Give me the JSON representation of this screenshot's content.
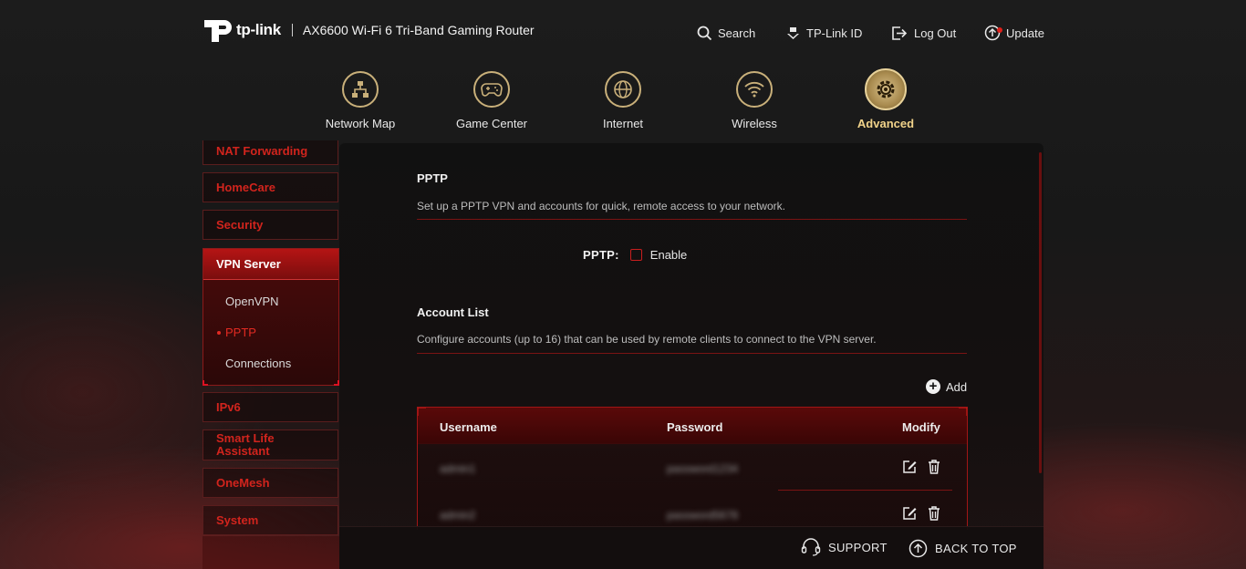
{
  "header": {
    "brand": "tp-link",
    "model": "AX6600 Wi-Fi 6 Tri-Band Gaming Router",
    "links": {
      "search": "Search",
      "tplink_id": "TP-Link ID",
      "logout": "Log Out",
      "update": "Update"
    }
  },
  "main_nav": {
    "network_map": "Network Map",
    "game_center": "Game Center",
    "internet": "Internet",
    "wireless": "Wireless",
    "advanced": "Advanced"
  },
  "sidebar": {
    "nat_forwarding": "NAT Forwarding",
    "homecare": "HomeCare",
    "security": "Security",
    "vpn_server": "VPN Server",
    "openvpn": "OpenVPN",
    "pptp": "PPTP",
    "connections": "Connections",
    "ipv6": "IPv6",
    "smart_life_line1": "Smart Life",
    "smart_life_line2": "Assistant",
    "onemesh": "OneMesh",
    "system": "System"
  },
  "pptp_section": {
    "title": "PPTP",
    "description": "Set up a PPTP VPN and accounts for quick, remote access to your network.",
    "field_label": "PPTP:",
    "enable_label": "Enable",
    "enabled": false
  },
  "account_section": {
    "title": "Account List",
    "description": "Configure accounts (up to 16) that can be used by remote clients to connect to the VPN server.",
    "add_label": "Add",
    "columns": {
      "username": "Username",
      "password": "Password",
      "modify": "Modify"
    },
    "rows": [
      {
        "username": "admin1",
        "password": "password1234"
      },
      {
        "username": "admin2",
        "password": "password5678"
      }
    ]
  },
  "footer": {
    "support": "SUPPORT",
    "back_to_top": "BACK TO TOP"
  },
  "colors": {
    "accent_red": "#d2241d",
    "accent_gold": "#c9b07a"
  }
}
